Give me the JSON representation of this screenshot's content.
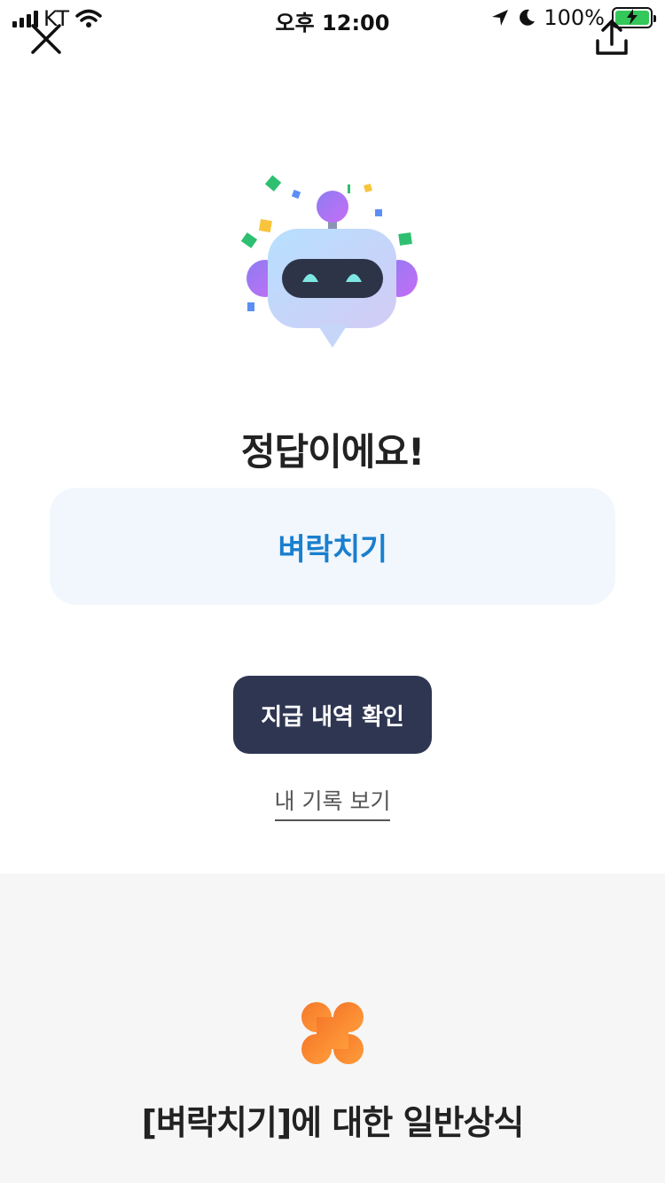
{
  "status_bar": {
    "carrier": "KT",
    "time": "오후 12:00",
    "battery_percent": "100%"
  },
  "header": {
    "close_icon": "close-icon",
    "share_icon": "share-icon"
  },
  "result": {
    "mascot_icon": "robot-mascot",
    "title": "정답이에요!",
    "answer": "벼락치기"
  },
  "actions": {
    "primary_label": "지급 내역 확인",
    "history_link_label": "내 기록 보기"
  },
  "knowledge": {
    "icon": "clover-icon",
    "title": "[벼락치기]에 대한 일반상식"
  },
  "colors": {
    "answer_text": "#1a7fce",
    "answer_background": "#f1f7fd",
    "primary_button": "#2f3652",
    "clover": "#f58b2e",
    "battery": "#34c759"
  }
}
